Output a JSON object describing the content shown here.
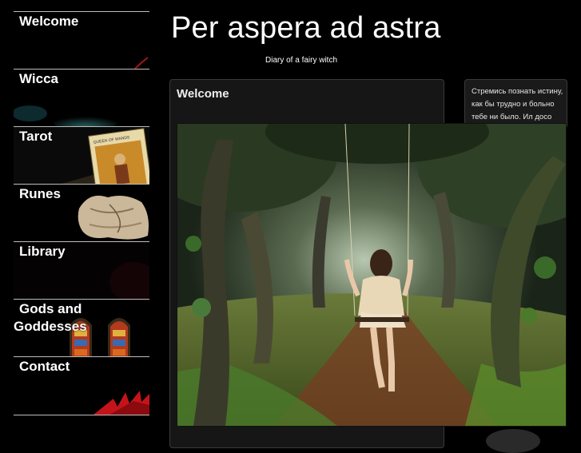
{
  "site": {
    "title": "Per aspera ad astra",
    "subtitle": "Diary of a fairy witch"
  },
  "sidebar": {
    "items": [
      {
        "label": "Welcome"
      },
      {
        "label": "Wicca"
      },
      {
        "label": "Tarot"
      },
      {
        "label": "Runes"
      },
      {
        "label": "Library"
      },
      {
        "label_line1": "Gods and",
        "label_line2": "Goddesses"
      },
      {
        "label": "Contact"
      }
    ],
    "tarot_card_text": "QUEEN OF WANDS"
  },
  "post": {
    "title": "Welcome"
  },
  "widget": {
    "text": "Стремись познать истину, как бы трудно и больно тебе ни было. Ил досо"
  },
  "colors": {
    "background": "#000000",
    "post_bg": "#161616",
    "divider": "#bdbdbd"
  }
}
